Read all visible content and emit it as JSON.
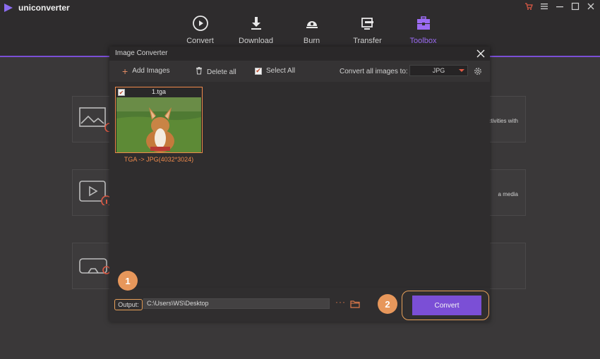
{
  "app": {
    "name": "uniconverter"
  },
  "nav": {
    "items": [
      {
        "label": "Convert",
        "icon": "convert-icon"
      },
      {
        "label": "Download",
        "icon": "download-icon"
      },
      {
        "label": "Burn",
        "icon": "burn-icon"
      },
      {
        "label": "Transfer",
        "icon": "transfer-icon"
      },
      {
        "label": "Toolbox",
        "icon": "toolbox-icon",
        "active": true
      }
    ]
  },
  "background": {
    "card_texts": [
      "ctivities with",
      "a media",
      ""
    ]
  },
  "dialog": {
    "title": "Image Converter",
    "toolbar": {
      "add_images": "Add Images",
      "delete_all": "Delete all",
      "select_all": "Select All",
      "convert_all_label": "Convert all images to:",
      "format": "JPG"
    },
    "files": [
      {
        "name": "1.tga",
        "caption": "TGA -> JPG(4032*3024)",
        "checked": true
      }
    ],
    "footer": {
      "output_label": "Output:",
      "output_path": "C:\\Users\\WS\\Desktop",
      "more": "···",
      "convert_button": "Convert"
    }
  },
  "annotations": {
    "step1": "1",
    "step2": "2"
  },
  "colors": {
    "accent": "#7b4fd6",
    "highlight": "#e8a15a",
    "close": "#e05a45"
  }
}
